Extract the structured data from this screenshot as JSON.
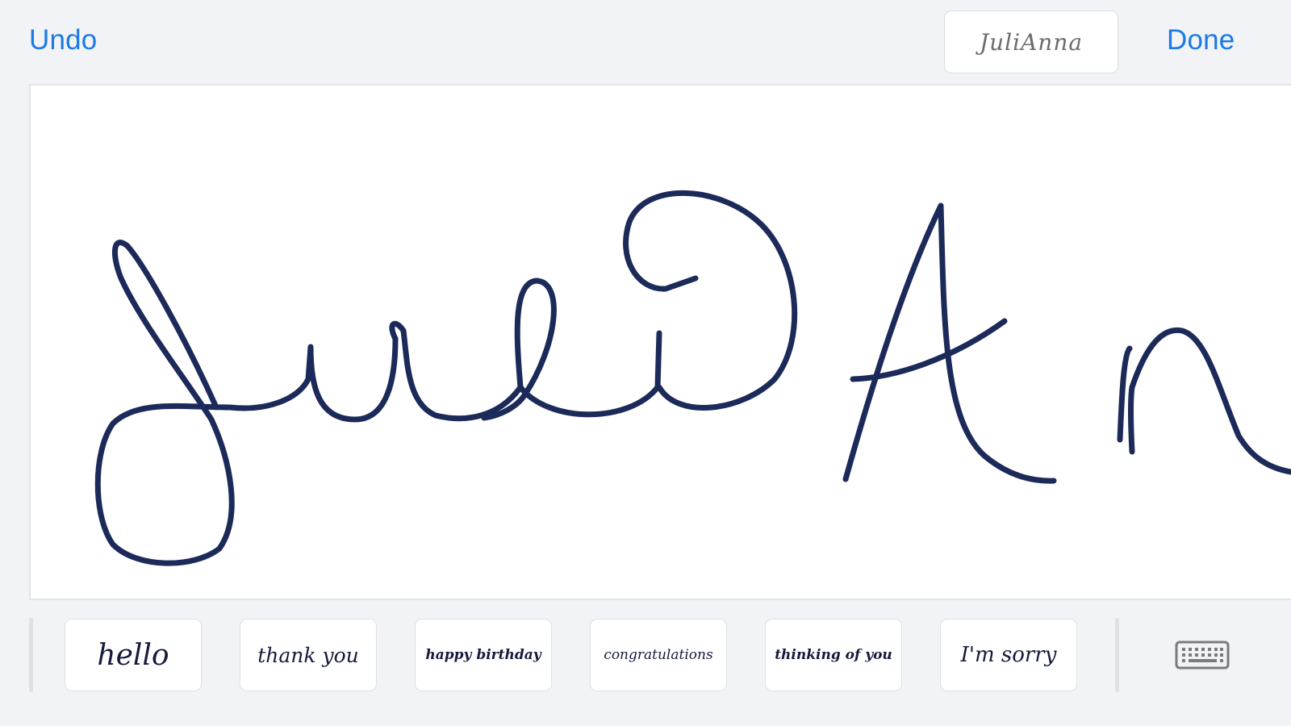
{
  "toolbar": {
    "undo_label": "Undo",
    "done_label": "Done",
    "preview_text": "JuliAnna"
  },
  "canvas": {
    "ink_color": "#1c2a5a",
    "handwriting_text": "JuliAnn",
    "scroll_indicator_icon": "chevron-right-icon"
  },
  "phrases": [
    {
      "label": "hello"
    },
    {
      "label": "thank you"
    },
    {
      "label": "happy birthday"
    },
    {
      "label": "congratulations"
    },
    {
      "label": "thinking of you"
    },
    {
      "label": "I'm sorry"
    }
  ],
  "keyboard_button": {
    "icon": "keyboard-icon"
  },
  "colors": {
    "accent": "#1a7ae6",
    "background": "#f2f3f6",
    "canvas": "#ffffff"
  }
}
